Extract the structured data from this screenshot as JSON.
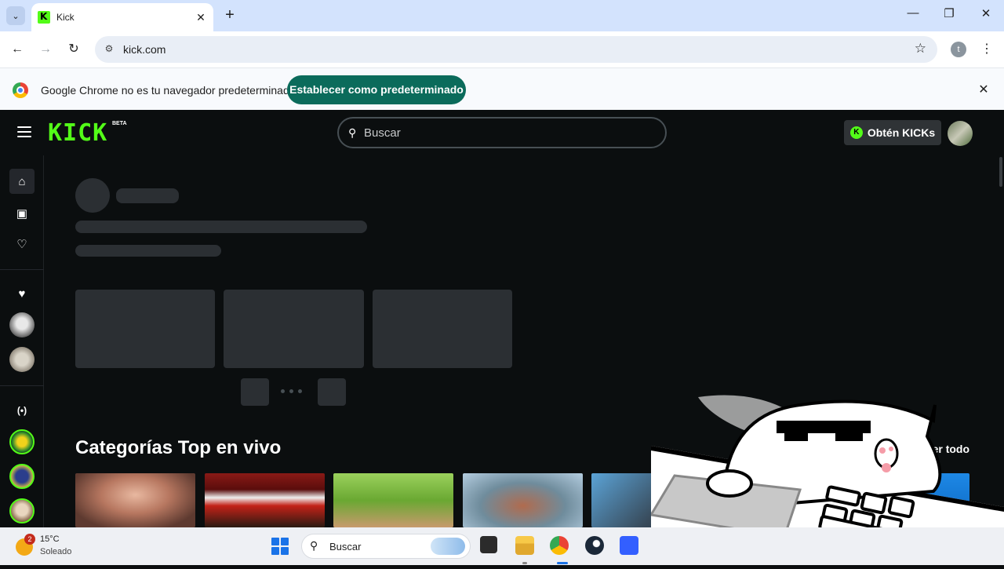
{
  "browser": {
    "tab": {
      "title": "Kick",
      "close": "✕"
    },
    "new_tab": "+",
    "window_controls": {
      "minimize": "—",
      "maximize": "❐",
      "close": "✕"
    },
    "nav": {
      "back": "←",
      "forward": "→",
      "reload": "↻"
    },
    "address": "kick.com",
    "profile_initial": "t",
    "infobar": {
      "message": "Google Chrome no es tu navegador predeterminado",
      "button": "Establecer como predeterminado",
      "close": "✕"
    }
  },
  "kick": {
    "logo": "KICK",
    "logo_badge": "BETA",
    "search_placeholder": "Buscar",
    "get_kicks": "Obtén KICKs",
    "section_title": "Categorías Top en vivo",
    "see_all": "Ver todo",
    "accent": "#53fc18"
  },
  "taskbar": {
    "weather_temp": "15°C",
    "weather_condition": "Soleado",
    "weather_badge": "2",
    "search_label": "Buscar"
  }
}
